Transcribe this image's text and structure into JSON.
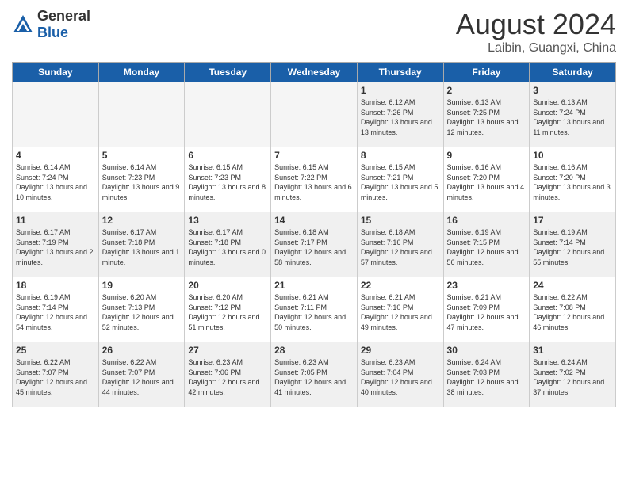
{
  "header": {
    "logo_general": "General",
    "logo_blue": "Blue",
    "month_title": "August 2024",
    "location": "Laibin, Guangxi, China"
  },
  "days_of_week": [
    "Sunday",
    "Monday",
    "Tuesday",
    "Wednesday",
    "Thursday",
    "Friday",
    "Saturday"
  ],
  "weeks": [
    [
      {
        "day": "",
        "empty": true
      },
      {
        "day": "",
        "empty": true
      },
      {
        "day": "",
        "empty": true
      },
      {
        "day": "",
        "empty": true
      },
      {
        "day": "1",
        "info": "Sunrise: 6:12 AM\nSunset: 7:26 PM\nDaylight: 13 hours\nand 13 minutes."
      },
      {
        "day": "2",
        "info": "Sunrise: 6:13 AM\nSunset: 7:25 PM\nDaylight: 13 hours\nand 12 minutes."
      },
      {
        "day": "3",
        "info": "Sunrise: 6:13 AM\nSunset: 7:24 PM\nDaylight: 13 hours\nand 11 minutes."
      }
    ],
    [
      {
        "day": "4",
        "info": "Sunrise: 6:14 AM\nSunset: 7:24 PM\nDaylight: 13 hours\nand 10 minutes."
      },
      {
        "day": "5",
        "info": "Sunrise: 6:14 AM\nSunset: 7:23 PM\nDaylight: 13 hours\nand 9 minutes."
      },
      {
        "day": "6",
        "info": "Sunrise: 6:15 AM\nSunset: 7:23 PM\nDaylight: 13 hours\nand 8 minutes."
      },
      {
        "day": "7",
        "info": "Sunrise: 6:15 AM\nSunset: 7:22 PM\nDaylight: 13 hours\nand 6 minutes."
      },
      {
        "day": "8",
        "info": "Sunrise: 6:15 AM\nSunset: 7:21 PM\nDaylight: 13 hours\nand 5 minutes."
      },
      {
        "day": "9",
        "info": "Sunrise: 6:16 AM\nSunset: 7:20 PM\nDaylight: 13 hours\nand 4 minutes."
      },
      {
        "day": "10",
        "info": "Sunrise: 6:16 AM\nSunset: 7:20 PM\nDaylight: 13 hours\nand 3 minutes."
      }
    ],
    [
      {
        "day": "11",
        "info": "Sunrise: 6:17 AM\nSunset: 7:19 PM\nDaylight: 13 hours\nand 2 minutes."
      },
      {
        "day": "12",
        "info": "Sunrise: 6:17 AM\nSunset: 7:18 PM\nDaylight: 13 hours\nand 1 minute."
      },
      {
        "day": "13",
        "info": "Sunrise: 6:17 AM\nSunset: 7:18 PM\nDaylight: 13 hours\nand 0 minutes."
      },
      {
        "day": "14",
        "info": "Sunrise: 6:18 AM\nSunset: 7:17 PM\nDaylight: 12 hours\nand 58 minutes."
      },
      {
        "day": "15",
        "info": "Sunrise: 6:18 AM\nSunset: 7:16 PM\nDaylight: 12 hours\nand 57 minutes."
      },
      {
        "day": "16",
        "info": "Sunrise: 6:19 AM\nSunset: 7:15 PM\nDaylight: 12 hours\nand 56 minutes."
      },
      {
        "day": "17",
        "info": "Sunrise: 6:19 AM\nSunset: 7:14 PM\nDaylight: 12 hours\nand 55 minutes."
      }
    ],
    [
      {
        "day": "18",
        "info": "Sunrise: 6:19 AM\nSunset: 7:14 PM\nDaylight: 12 hours\nand 54 minutes."
      },
      {
        "day": "19",
        "info": "Sunrise: 6:20 AM\nSunset: 7:13 PM\nDaylight: 12 hours\nand 52 minutes."
      },
      {
        "day": "20",
        "info": "Sunrise: 6:20 AM\nSunset: 7:12 PM\nDaylight: 12 hours\nand 51 minutes."
      },
      {
        "day": "21",
        "info": "Sunrise: 6:21 AM\nSunset: 7:11 PM\nDaylight: 12 hours\nand 50 minutes."
      },
      {
        "day": "22",
        "info": "Sunrise: 6:21 AM\nSunset: 7:10 PM\nDaylight: 12 hours\nand 49 minutes."
      },
      {
        "day": "23",
        "info": "Sunrise: 6:21 AM\nSunset: 7:09 PM\nDaylight: 12 hours\nand 47 minutes."
      },
      {
        "day": "24",
        "info": "Sunrise: 6:22 AM\nSunset: 7:08 PM\nDaylight: 12 hours\nand 46 minutes."
      }
    ],
    [
      {
        "day": "25",
        "info": "Sunrise: 6:22 AM\nSunset: 7:07 PM\nDaylight: 12 hours\nand 45 minutes."
      },
      {
        "day": "26",
        "info": "Sunrise: 6:22 AM\nSunset: 7:07 PM\nDaylight: 12 hours\nand 44 minutes."
      },
      {
        "day": "27",
        "info": "Sunrise: 6:23 AM\nSunset: 7:06 PM\nDaylight: 12 hours\nand 42 minutes."
      },
      {
        "day": "28",
        "info": "Sunrise: 6:23 AM\nSunset: 7:05 PM\nDaylight: 12 hours\nand 41 minutes."
      },
      {
        "day": "29",
        "info": "Sunrise: 6:23 AM\nSunset: 7:04 PM\nDaylight: 12 hours\nand 40 minutes."
      },
      {
        "day": "30",
        "info": "Sunrise: 6:24 AM\nSunset: 7:03 PM\nDaylight: 12 hours\nand 38 minutes."
      },
      {
        "day": "31",
        "info": "Sunrise: 6:24 AM\nSunset: 7:02 PM\nDaylight: 12 hours\nand 37 minutes."
      }
    ]
  ]
}
